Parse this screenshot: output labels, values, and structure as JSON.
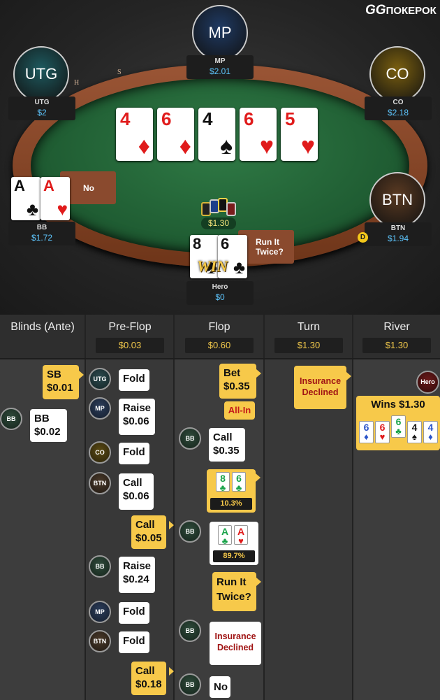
{
  "brand": {
    "logo_gg": "GG",
    "logo_text": "ПОКЕРОК"
  },
  "table": {
    "rail_letters": [
      "H",
      "S",
      "S",
      "U",
      "S",
      "S"
    ],
    "pot": "$1.30",
    "dealer_button": "D",
    "win_badge": "WIN",
    "board": [
      {
        "rank": "4",
        "suit": "♦",
        "color": "red"
      },
      {
        "rank": "6",
        "suit": "♦",
        "color": "red"
      },
      {
        "rank": "4",
        "suit": "♠",
        "color": "black"
      },
      {
        "rank": "6",
        "suit": "♥",
        "color": "red"
      },
      {
        "rank": "5",
        "suit": "♥",
        "color": "red"
      }
    ],
    "players": {
      "mp": {
        "bubble": "MP",
        "name": "MP",
        "stack": "$2.01",
        "color": "#1f3a63"
      },
      "utg": {
        "bubble": "UTG",
        "name": "UTG",
        "stack": "$2",
        "color": "#1e5a5f"
      },
      "co": {
        "bubble": "CO",
        "name": "CO",
        "stack": "$2.18",
        "color": "#7a5f10"
      },
      "btn": {
        "bubble": "BTN",
        "name": "BTN",
        "stack": "$1.94",
        "color": "#5a3a22"
      },
      "bb": {
        "name": "BB",
        "stack": "$1.72",
        "bubble_text": "No",
        "cards": [
          {
            "rank": "A",
            "suit": "♣",
            "color": "black"
          },
          {
            "rank": "A",
            "suit": "♥",
            "color": "red"
          }
        ]
      },
      "hero": {
        "name": "Hero",
        "stack": "$0",
        "bubble_text": "Run It Twice?",
        "cards": [
          {
            "rank": "8",
            "suit": "♣",
            "color": "black"
          },
          {
            "rank": "6",
            "suit": "♣",
            "color": "black"
          }
        ]
      }
    }
  },
  "history": {
    "columns": [
      {
        "title": "Blinds (Ante)",
        "pot": ""
      },
      {
        "title": "Pre-Flop",
        "pot": "$0.03"
      },
      {
        "title": "Flop",
        "pot": "$0.60"
      },
      {
        "title": "Turn",
        "pot": "$1.30"
      },
      {
        "title": "River",
        "pot": "$1.30"
      }
    ],
    "blinds": [
      {
        "who": "SB",
        "label": "SB",
        "amount": "$0.01"
      },
      {
        "who": "BB",
        "label": "BB",
        "amount": "$0.02"
      }
    ],
    "preflop": [
      {
        "who": "UTG",
        "action": "Fold"
      },
      {
        "who": "MP",
        "action": "Raise",
        "amount": "$0.06"
      },
      {
        "who": "CO",
        "action": "Fold"
      },
      {
        "who": "BTN",
        "action": "Call",
        "amount": "$0.06"
      },
      {
        "who": "SB",
        "action": "Call",
        "amount": "$0.05"
      },
      {
        "who": "BB",
        "action": "Raise",
        "amount": "$0.24"
      },
      {
        "who": "MP",
        "action": "Fold"
      },
      {
        "who": "BTN",
        "action": "Fold"
      },
      {
        "who": "SB",
        "action": "Call",
        "amount": "$0.18"
      }
    ],
    "flop": {
      "hero_bet": {
        "action": "Bet",
        "amount": "$0.35",
        "tag": "All-In"
      },
      "bb_call": {
        "who": "BB",
        "action": "Call",
        "amount": "$0.35"
      },
      "hero_equity": {
        "pct": "10.3%",
        "cards": [
          {
            "rank": "8",
            "suit": "♣",
            "color": "green"
          },
          {
            "rank": "6",
            "suit": "♣",
            "color": "green"
          }
        ]
      },
      "bb_equity": {
        "who": "BB",
        "pct": "89.7%",
        "cards": [
          {
            "rank": "A",
            "suit": "♣",
            "color": "green"
          },
          {
            "rank": "A",
            "suit": "♥",
            "color": "red"
          }
        ]
      },
      "hero_rit": {
        "text": "Run It Twice?"
      },
      "bb_insurance": {
        "who": "BB",
        "text": "Insurance Declined"
      },
      "bb_no": {
        "who": "BB",
        "text": "No"
      }
    },
    "turn": {
      "hero_insurance": {
        "text": "Insurance Declined"
      }
    },
    "river": {
      "winner": "Hero",
      "wins_text": "Wins $1.30",
      "cards": [
        {
          "rank": "6",
          "suit": "♦",
          "color": "blue"
        },
        {
          "rank": "6",
          "suit": "♥",
          "color": "red"
        },
        {
          "rank": "6",
          "suit": "♣",
          "color": "green"
        },
        {
          "rank": "4",
          "suit": "♠",
          "color": "black"
        },
        {
          "rank": "4",
          "suit": "♦",
          "color": "blue"
        }
      ]
    }
  }
}
